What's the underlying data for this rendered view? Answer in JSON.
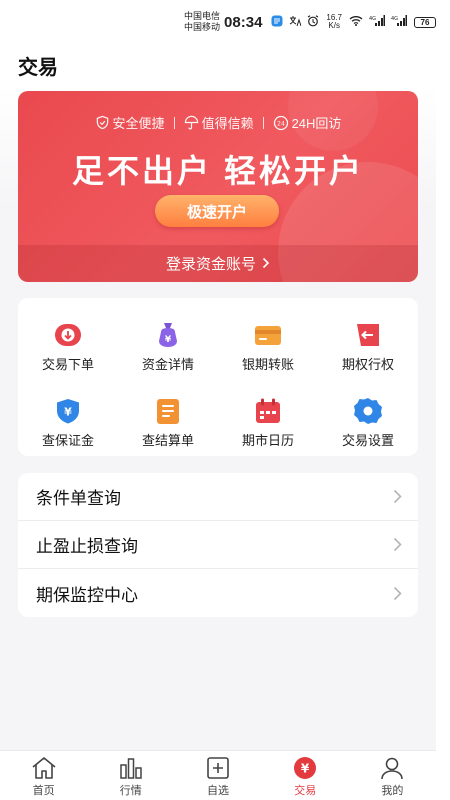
{
  "status_bar": {
    "carrier1": "中国电信",
    "carrier2": "中国移动",
    "time": "08:34",
    "speed_value": "16.7",
    "speed_unit": "K/s",
    "battery": "76"
  },
  "header": {
    "title": "交易"
  },
  "banner": {
    "features": [
      "安全便捷",
      "值得信赖",
      "24H回访"
    ],
    "slogan": "足不出户  轻松开户",
    "button": "极速开户",
    "login_link": "登录资金账号",
    "colors": {
      "banner": "#e9494e",
      "button": "#ff8a45"
    }
  },
  "grid": {
    "items": [
      {
        "label": "交易下单",
        "icon": "arrow-down-circle-icon"
      },
      {
        "label": "资金详情",
        "icon": "money-bag-icon"
      },
      {
        "label": "银期转账",
        "icon": "card-icon"
      },
      {
        "label": "期权行权",
        "icon": "arrow-left-tag-icon"
      },
      {
        "label": "查保证金",
        "icon": "yuan-shield-icon"
      },
      {
        "label": "查结算单",
        "icon": "document-icon"
      },
      {
        "label": "期市日历",
        "icon": "calendar-icon"
      },
      {
        "label": "交易设置",
        "icon": "gear-icon"
      }
    ]
  },
  "list": {
    "items": [
      {
        "label": "条件单查询"
      },
      {
        "label": "止盈止损查询"
      },
      {
        "label": "期保监控中心"
      }
    ]
  },
  "bottom_nav": {
    "items": [
      {
        "label": "首页",
        "icon": "home-icon"
      },
      {
        "label": "行情",
        "icon": "bar-chart-icon"
      },
      {
        "label": "自选",
        "icon": "plus-square-icon"
      },
      {
        "label": "交易",
        "icon": "yuan-circle-icon",
        "active": true
      },
      {
        "label": "我的",
        "icon": "user-icon"
      }
    ],
    "active_color": "#e33a3f"
  }
}
